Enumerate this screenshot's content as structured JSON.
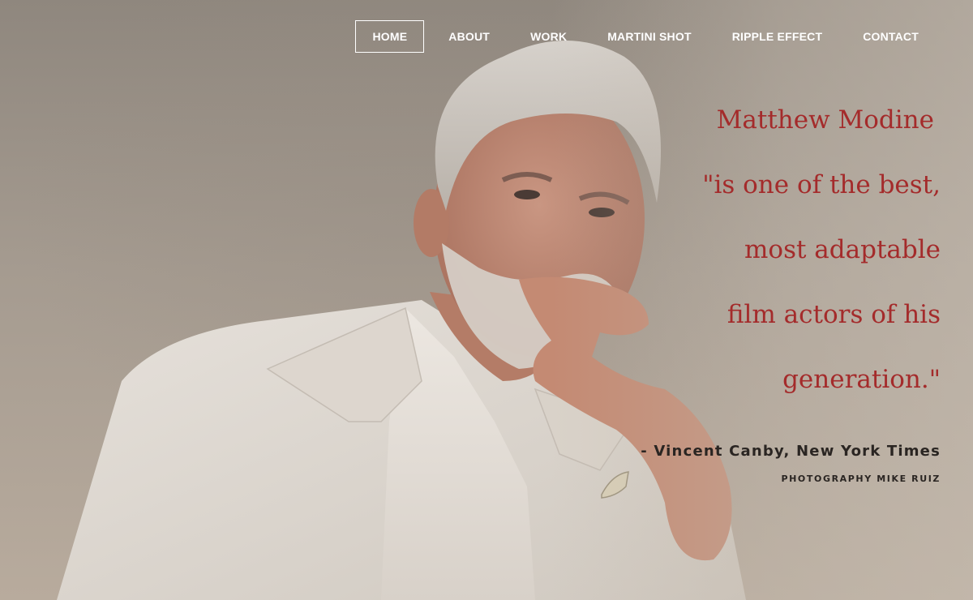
{
  "nav": {
    "items": [
      {
        "label": "HOME",
        "active": true
      },
      {
        "label": "ABOUT",
        "active": false
      },
      {
        "label": "WORK",
        "active": false
      },
      {
        "label": "MARTINI SHOT",
        "active": false
      },
      {
        "label": "RIPPLE EFFECT",
        "active": false
      },
      {
        "label": "CONTACT",
        "active": false
      }
    ]
  },
  "hero": {
    "quote_lines": [
      "Matthew Modine",
      "\"is one of the best,",
      "most adaptable",
      "film actors of his",
      "generation.\""
    ],
    "attribution": "- Vincent Canby, New York Times",
    "credit": "PHOTOGRAPHY MIKE RUIZ"
  },
  "colors": {
    "quote_text": "#a42b2b",
    "nav_text": "#ffffff",
    "attribution_text": "#2a2522",
    "background": "#9a8f86"
  }
}
